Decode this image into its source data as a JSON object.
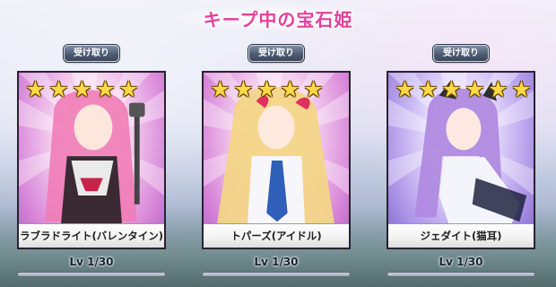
{
  "header": {
    "title": "キープ中の宝石姫"
  },
  "slots": [
    {
      "button_label": "受け取り",
      "stars": 5,
      "name": "ラブラドライト(バレンタイン)",
      "level": "Lv 1/30",
      "exp_fraction": 0,
      "card_color": "#d886d9",
      "hair_color": "#f07cb6"
    },
    {
      "button_label": "受け取り",
      "stars": 5,
      "name": "トパーズ(アイドル)",
      "level": "Lv 1/30",
      "exp_fraction": 0,
      "card_color": "#d886d9",
      "hair_color": "#f3d587"
    },
    {
      "button_label": "受け取り",
      "stars": 6,
      "name": "ジェダイト(猫耳)",
      "level": "Lv 1/30",
      "exp_fraction": 0,
      "card_color": "#a990e6",
      "hair_color": "#b08ae0"
    }
  ],
  "icons": {
    "star": "star-icon"
  }
}
